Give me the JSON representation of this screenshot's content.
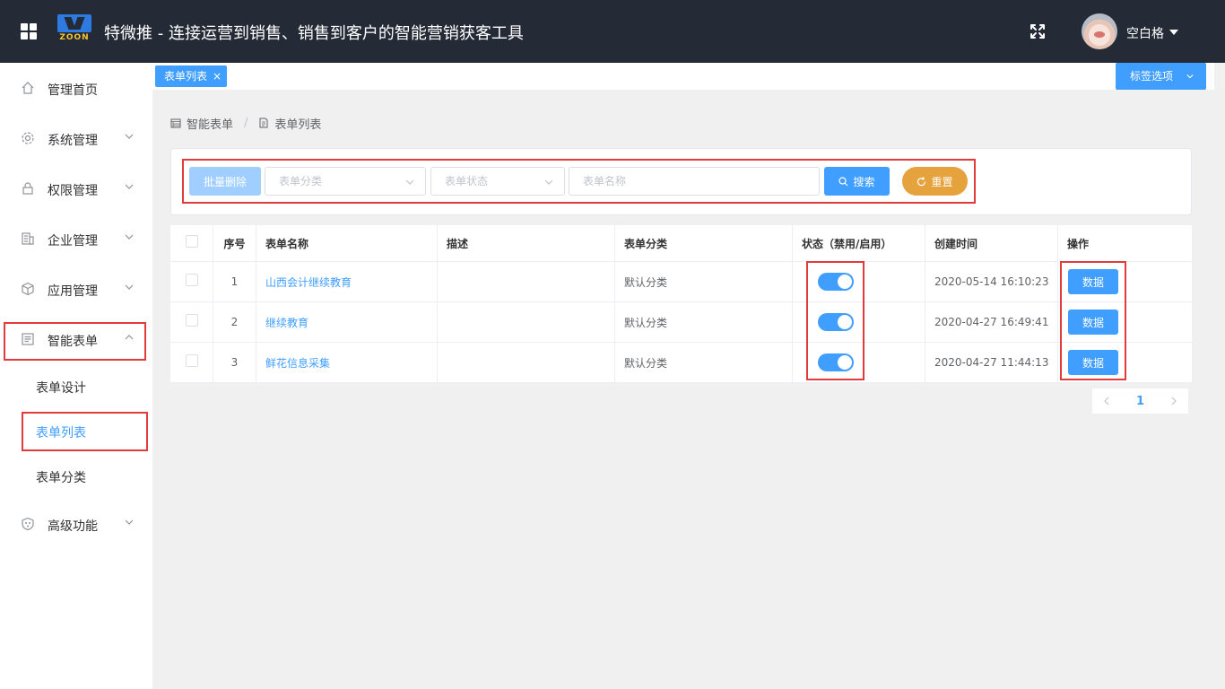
{
  "header": {
    "logo_text": "ZOON",
    "title": "特微推 - 连接运营到销售、销售到客户的智能营销获客工具",
    "username": "空白格"
  },
  "sidebar": {
    "items": [
      {
        "label": "管理首页",
        "icon": "home-icon"
      },
      {
        "label": "系统管理",
        "icon": "gear-icon"
      },
      {
        "label": "权限管理",
        "icon": "lock-icon"
      },
      {
        "label": "企业管理",
        "icon": "building-icon"
      },
      {
        "label": "应用管理",
        "icon": "cube-icon"
      },
      {
        "label": "智能表单",
        "icon": "form-icon",
        "expanded": true
      },
      {
        "label": "高级功能",
        "icon": "shield-icon"
      }
    ],
    "submenu": [
      {
        "label": "表单设计"
      },
      {
        "label": "表单列表",
        "active": true
      },
      {
        "label": "表单分类"
      }
    ]
  },
  "tagbar": {
    "tags": [
      {
        "label": "表单列表",
        "close": "×"
      }
    ],
    "options_label": "标签选项"
  },
  "breadcrumb": {
    "items": [
      {
        "label": "智能表单",
        "icon": "calendar-icon"
      },
      {
        "label": "表单列表",
        "icon": "document-icon"
      }
    ],
    "separator": "/"
  },
  "search": {
    "batch_delete_label": "批量删除",
    "category_placeholder": "表单分类",
    "status_placeholder": "表单状态",
    "name_placeholder": "表单名称",
    "search_label": "搜索",
    "reset_label": "重置"
  },
  "table": {
    "headers": [
      "",
      "序号",
      "表单名称",
      "描述",
      "表单分类",
      "状态（禁用/启用）",
      "创建时间",
      "操作"
    ],
    "rows": [
      {
        "index": "1",
        "name": "山西会计继续教育",
        "desc": "",
        "category": "默认分类",
        "enabled": true,
        "created": "2020-05-14 16:10:23",
        "action": "数据"
      },
      {
        "index": "2",
        "name": "继续教育",
        "desc": "",
        "category": "默认分类",
        "enabled": true,
        "created": "2020-04-27 16:49:41",
        "action": "数据"
      },
      {
        "index": "3",
        "name": "鲜花信息采集",
        "desc": "",
        "category": "默认分类",
        "enabled": true,
        "created": "2020-04-27 11:44:13",
        "action": "数据"
      }
    ]
  },
  "pagination": {
    "current_page": "1"
  },
  "colors": {
    "header_bg": "#242b37",
    "primary": "#409eff",
    "warning": "#e6a23c",
    "highlight_box": "#e23b3b"
  }
}
